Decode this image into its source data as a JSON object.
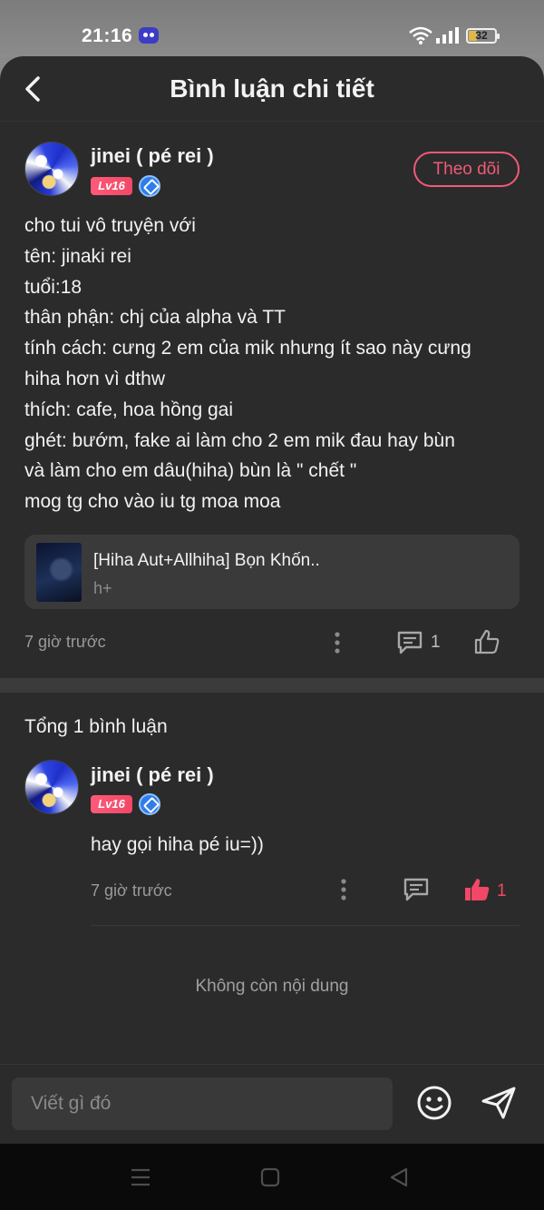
{
  "status_bar": {
    "time": "21:16",
    "battery": "32"
  },
  "header": {
    "title": "Bình luận chi tiết"
  },
  "post": {
    "author": "jinei ( pé rei )",
    "level": "Lv16",
    "follow_label": "Theo dõi",
    "lines": [
      "cho tui vô truyện với",
      "tên: jinaki rei",
      "tuổi:18",
      "thân phận: chj của alpha và TT",
      "tính cách: cưng 2 em của mik nhưng ít sao này cưng",
      "hiha hơn vì dthw",
      "thích: cafe, hoa hồng gai",
      "ghét: bướm, fake ai làm cho 2 em mik đau hay bùn",
      "và làm cho em dâu(hiha) bùn là \" chết \"",
      "mog tg cho vào iu tg moa moa"
    ],
    "story": {
      "title": "[Hiha Aut+Allhiha] Bọn Khốn..",
      "subtitle": "h+"
    },
    "time": "7 giờ trước",
    "comment_count": "1"
  },
  "comments_section": {
    "total_label": "Tổng 1 bình luận",
    "reply": {
      "author": "jinei ( pé rei )",
      "level": "Lv16",
      "text": "hay gọi hiha pé iu=))",
      "time": "7 giờ trước",
      "like_count": "1"
    },
    "end_label": "Không còn nội dung"
  },
  "input": {
    "placeholder": "Viết gì đó"
  },
  "colors": {
    "accent": "#f05a78",
    "like_active": "#f04866",
    "background": "#2b2b2b"
  }
}
